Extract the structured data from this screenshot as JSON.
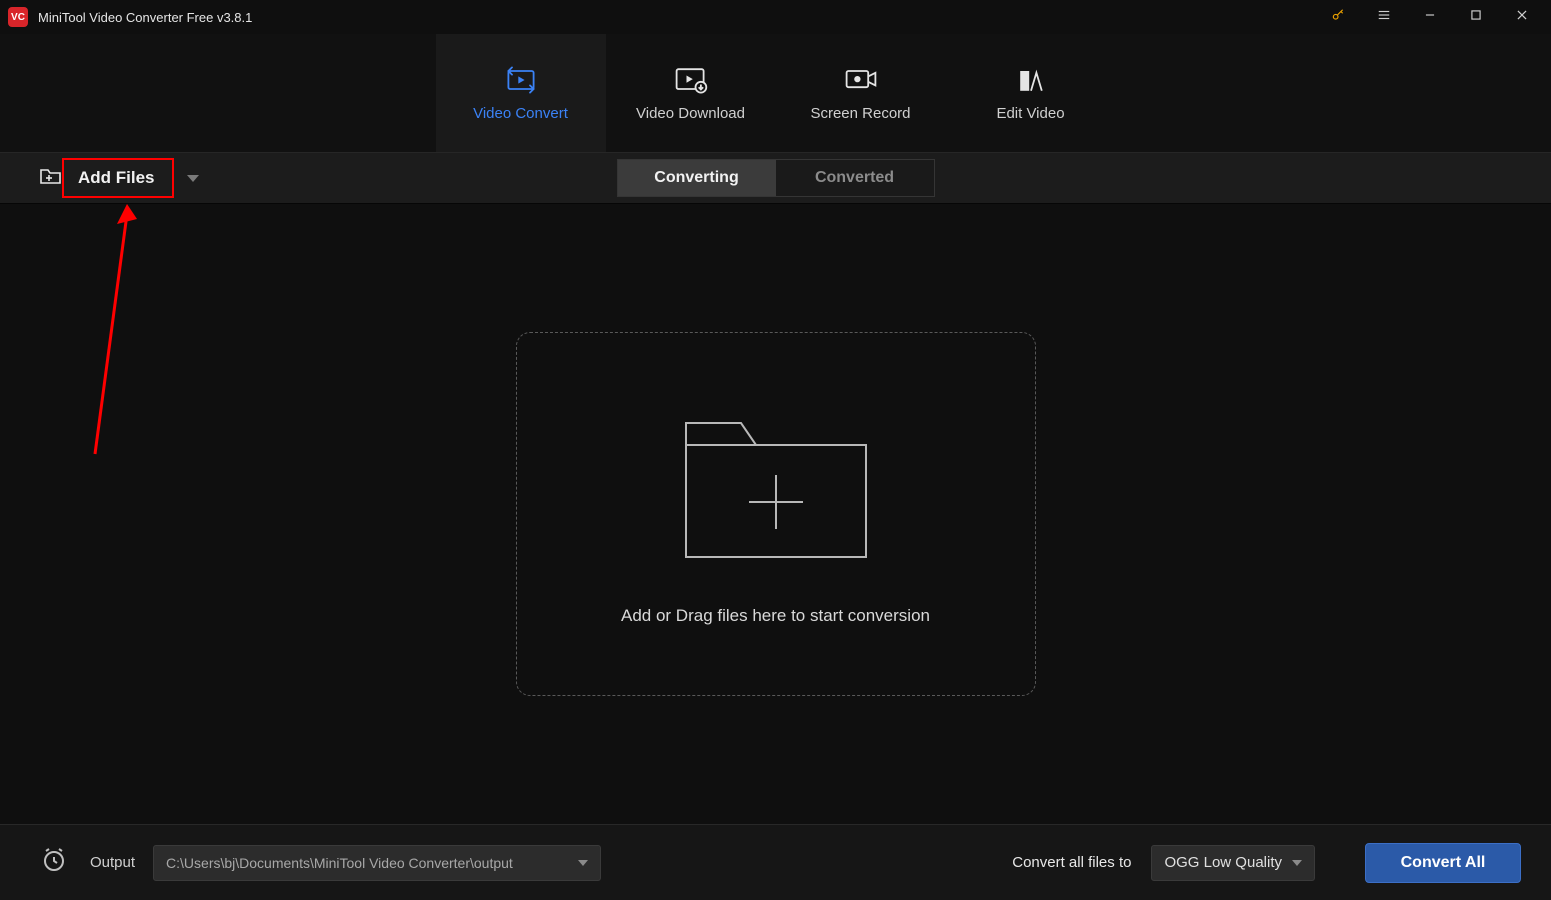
{
  "app": {
    "title": "MiniTool Video Converter Free v3.8.1"
  },
  "nav": {
    "tabs": [
      {
        "label": "Video Convert"
      },
      {
        "label": "Video Download"
      },
      {
        "label": "Screen Record"
      },
      {
        "label": "Edit Video"
      }
    ]
  },
  "secondbar": {
    "add_files_label": "Add Files",
    "status_tabs": [
      {
        "label": "Converting"
      },
      {
        "label": "Converted"
      }
    ]
  },
  "drop": {
    "text": "Add or Drag files here to start conversion"
  },
  "footer": {
    "output_label": "Output",
    "output_path": "C:\\Users\\bj\\Documents\\MiniTool Video Converter\\output",
    "convert_to_label": "Convert all files to",
    "format_selected": "OGG Low Quality",
    "convert_all_label": "Convert All"
  }
}
